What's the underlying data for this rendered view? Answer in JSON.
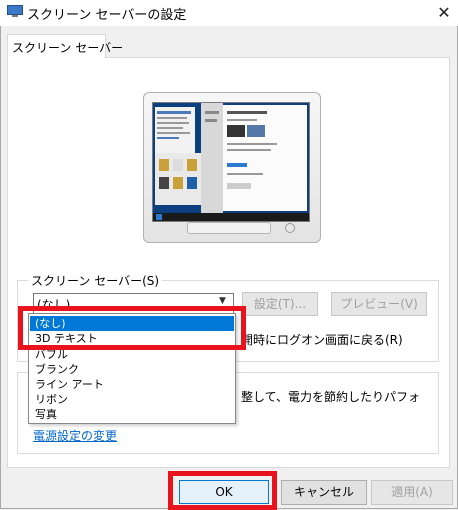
{
  "window": {
    "title": "スクリーン セーバーの設定",
    "close_glyph": "✕"
  },
  "tab": {
    "label": "スクリーン セーバー"
  },
  "screensaver_group": {
    "label": "スクリーン セーバー(S)",
    "selected_value": "(なし)",
    "settings_button": "設定(T)...",
    "preview_button": "プレビュー(V)",
    "resume_text": "開時にログオン画面に戻る(R)"
  },
  "dropdown": {
    "options": [
      "(なし)",
      "3D テキスト",
      "バブル",
      "ブランク",
      "ライン アート",
      "リボン",
      "写真"
    ],
    "selected_index": 0
  },
  "power_group": {
    "text": "整して、電力を節約したりパフォ",
    "link": "電源設定の変更"
  },
  "buttons": {
    "ok": "OK",
    "cancel": "キャンセル",
    "apply": "適用(A)"
  },
  "colors": {
    "highlight": "#e8131c",
    "selection": "#0078d7",
    "link": "#0066cc"
  }
}
